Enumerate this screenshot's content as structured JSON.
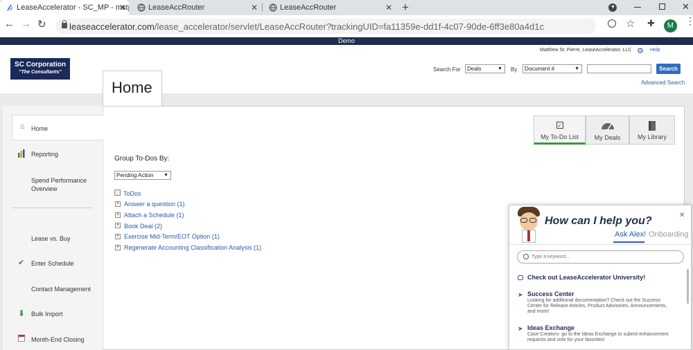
{
  "browser": {
    "tabs": [
      {
        "title": "LeaseAccelerator - SC_MP - mstp",
        "active": true
      },
      {
        "title": "LeaseAccRouter",
        "active": false
      },
      {
        "title": "LeaseAccRouter",
        "active": false
      }
    ],
    "url_host": "leaseaccelerator.com",
    "url_path": "/lease_accelerator/servlet/LeaseAccRouter?trackingUID=fa11359e-dd1f-4c07-90de-6ff3e80a4d1c",
    "profile_initial": "M"
  },
  "app": {
    "env_label": "Demo",
    "logo_line1": "SC Corporation",
    "logo_line2": "\"The Consultants\"",
    "user_name": "Matthew St. Pierre, LeaseAccelerator, LLC",
    "help_label": "Help",
    "search": {
      "search_for_label": "Search For",
      "search_for_value": "Deals",
      "by_label": "By",
      "by_value": "Document #",
      "input_value": "",
      "button_label": "Search",
      "advanced_label": "Advanced Search"
    },
    "page_tab": "Home"
  },
  "sidebar": {
    "items": [
      {
        "label": "Home"
      },
      {
        "label": "Reporting"
      },
      {
        "label": "Spend Performance Overview"
      },
      {
        "label": "Lease vs. Buy"
      },
      {
        "label": "Enter Schedule"
      },
      {
        "label": "Contact Management"
      },
      {
        "label": "Bulk Import"
      },
      {
        "label": "Month-End Closing"
      }
    ]
  },
  "main": {
    "group_label": "Group To-Dos By:",
    "group_value": "Pending Action",
    "todos_root": "ToDos",
    "todos": [
      "Answer a question (1)",
      "Attach a Schedule (1)",
      "Book Deal (2)",
      "Exercise Mid-Term/EOT Option (1)",
      "Regenerate Accounting Classification Analysis (1)"
    ],
    "widget_tabs": [
      {
        "label": "My To-Do List",
        "active": true
      },
      {
        "label": "My Deals",
        "active": false
      },
      {
        "label": "My Library",
        "active": false
      }
    ]
  },
  "help_widget": {
    "title": "How can I help you?",
    "tab_ask": "Ask Alex!",
    "tab_onboarding": "Onboarding",
    "search_placeholder": "Type a keyword...",
    "university": "Check out LeaseAccelerator University!",
    "items": [
      {
        "title": "Success Center",
        "desc": "Looking for additional documentation? Check out the Success Center for Release Articles, Product Advisories, Announcements, and more!"
      },
      {
        "title": "Ideas Exchange",
        "desc": "Case Creators- go to the Ideas Exchange to submit enhancement requests and vote for your favorites!"
      }
    ]
  },
  "colors": {
    "navy": "#1f2d4d",
    "link": "#2a5aa8",
    "search_button": "#2f6fbf",
    "active_green": "#3a9a3a"
  }
}
